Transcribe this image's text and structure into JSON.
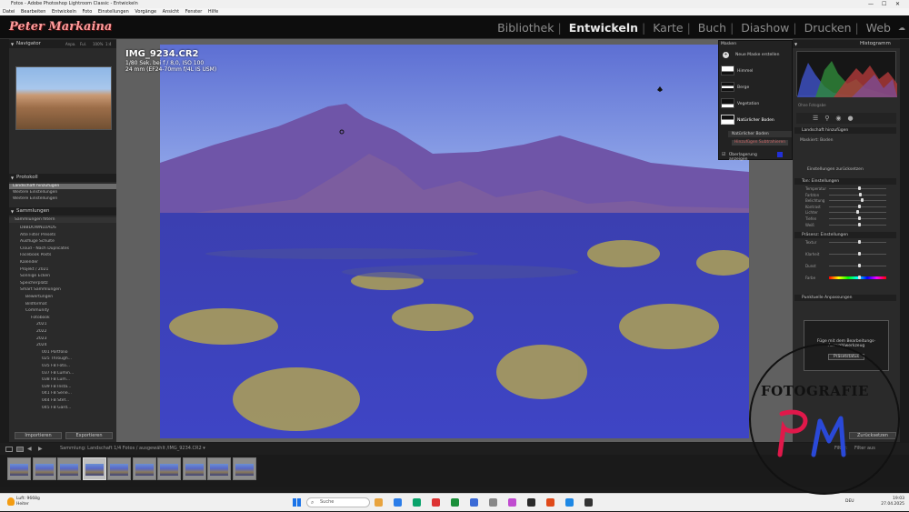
{
  "window": {
    "title": "Fotos - Adobe Photoshop Lightroom Classic - Entwickeln"
  },
  "menu": [
    "Datei",
    "Bearbeiten",
    "Entwickeln",
    "Foto",
    "Einstellungen",
    "Vorgänge",
    "Ansicht",
    "Fenster",
    "Hilfe"
  ],
  "identity": {
    "logo": "Peter Markaina"
  },
  "modules": {
    "items": [
      "Bibliothek",
      "Entwickeln",
      "Karte",
      "Buch",
      "Diashow",
      "Drucken",
      "Web"
    ],
    "active": "Entwickeln"
  },
  "left_panel": {
    "navigator": {
      "header": "Navigator",
      "zoom_options": [
        "Anpa.",
        "Ful.",
        "100%",
        "1:4"
      ]
    },
    "presets": {
      "header": "Protokoll",
      "items": [
        "Landschaft hinzufügen",
        "Weitere Einstellungen",
        "Weitere Einstellungen"
      ]
    },
    "collections": {
      "header": "Sammlungen",
      "filter_label": "Sammlungen filtern",
      "items": [
        "DBBDOWNLOADS",
        "Alte Filter Presets",
        "Ausflüge Schulte",
        "Cloud - Nach Duplicates",
        "Facebook Posts",
        "Kalender",
        "Projekt / 2021",
        "Sonnige Ecken",
        "Speicherplatz",
        "Smart Sammlungen",
        "Bewertungen",
        "Bildformat",
        "Community",
        "Fotobook",
        "2021",
        "2022",
        "2023",
        "2024",
        "001 Portfolio",
        "025 Through...",
        "035 FB Foto...",
        "037 FB Lumin...",
        "038 FB Lum...",
        "039 FB Insta...",
        "041 FB Serie...",
        "044 FB Stef...",
        "045 FB Gard..."
      ]
    },
    "buttons": {
      "import": "Importieren",
      "export": "Exportieren"
    }
  },
  "image_info": {
    "filename": "IMG_9234.CR2",
    "exposure": "1/80 Sek. bei f / 8,0, ISO 100",
    "lens": "24 mm (EF24-70mm f/4L IS USM)"
  },
  "masks_panel": {
    "title": "Masken",
    "create_new": "Neue Maske erstellen",
    "items": [
      "Himmel",
      "Berge",
      "Vegetation",
      "Natürlicher Boden"
    ],
    "selected_mask": "Natürlicher Boden",
    "subtract_button": "Hinzufügen Subtrahieren",
    "show_overlay": "Überlagerung anzeigen"
  },
  "right_panel": {
    "histogram_header": "Histogramm",
    "info": "Ohne Fotogabe",
    "mask_section": "Landschaft hinzufügen",
    "mask_amount_label": "Maskiert: Boden",
    "amount": "Einstellungen zurücksetzen",
    "tone_header": "Ton: Einstellungen",
    "tone_sliders": [
      "Temperatur",
      "Farbton",
      "Belichtung",
      "Kontrast",
      "Lichter",
      "Tiefen",
      "Weiß",
      "Schwarz"
    ],
    "color_header": "Präsenz: Einstellungen",
    "color_sliders": [
      "Textur",
      "Klarheit",
      "Dunst",
      "Farbe"
    ],
    "refine_header": "Punktuelle Anpassungen",
    "preview_text": "Füge mit dem Bearbeitungs-Auswahlwerkzeug",
    "preview_button": "Präsetstatus",
    "reset": "Zurücksetzen"
  },
  "filmbar": {
    "text": "Sammlung: Landschaft   1/4 Fotos / ausgewählt /IMG_9234.CR2 ▾",
    "filter": "Filter:",
    "filter_value": "Filter aus"
  },
  "filmstrip": {
    "count": 10,
    "selected_index": 3
  },
  "taskbar": {
    "weather_temp": "Luft: 9668g",
    "weather_desc": "Heiter",
    "search_placeholder": "Suche",
    "lang": "DEU",
    "time": "19:03",
    "date": "27.04.2025"
  },
  "watermark": {
    "text": "FOTOGRAFIE"
  },
  "colors": {
    "accent_active_module": "#e8e8e8",
    "mask_overlay": "#3f48c8",
    "taskbar": "#f0f0f0"
  }
}
